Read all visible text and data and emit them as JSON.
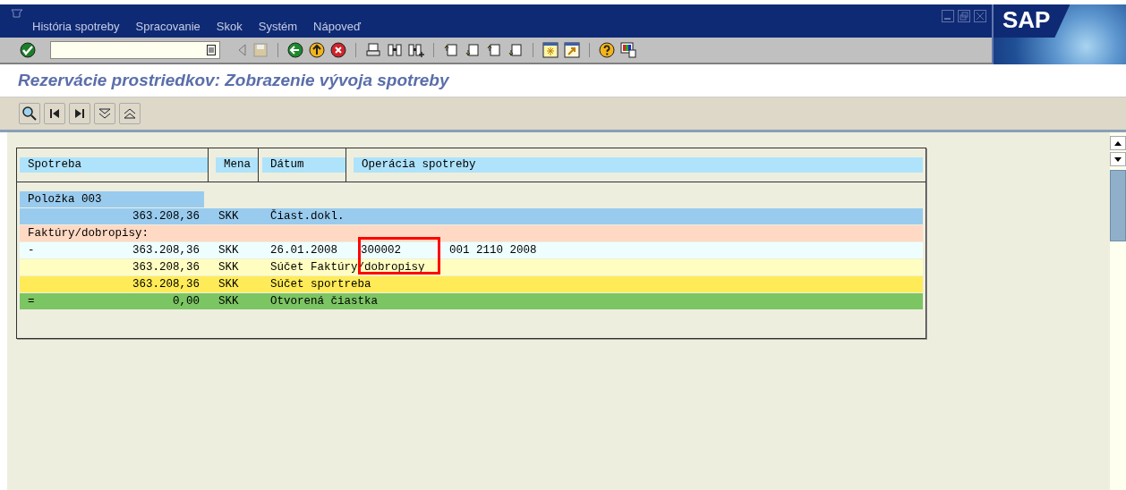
{
  "menu": [
    "História spotreby",
    "Spracovanie",
    "Skok",
    "Systém",
    "Nápoveď"
  ],
  "logo": "SAP",
  "title": "Rezervácie prostriedkov: Zobrazenie vývoja spotreby",
  "table": {
    "columns": [
      "Spotreba",
      "Mena",
      "Dátum",
      "Operácia spotreby"
    ],
    "rows": [
      {
        "kind": "group",
        "label": "Položka 003",
        "color": "#99cbee"
      },
      {
        "kind": "line",
        "amount": "363.208,36",
        "currency": "SKK",
        "text": "Čiast.dokl.",
        "color": "#99cbee"
      },
      {
        "kind": "section",
        "label": "Faktúry/dobropisy:",
        "color": "#ffd9c4"
      },
      {
        "kind": "line",
        "sign": "-",
        "amount": "363.208,36",
        "currency": "SKK",
        "date": "26.01.2008",
        "document": "300002",
        "marked": true,
        "text": "001 2110 2008",
        "color": "#eefeff"
      },
      {
        "kind": "line",
        "amount": "363.208,36",
        "currency": "SKK",
        "text": "Súčet Faktúry/dobropisy",
        "color": "#fffdc0"
      },
      {
        "kind": "line",
        "amount": "363.208,36",
        "currency": "SKK",
        "text": "Súčet sportreba",
        "color": "#ffeb57"
      },
      {
        "kind": "line",
        "sign": "=",
        "amount": "0,00",
        "currency": "SKK",
        "text": "Otvorená čiastka",
        "color": "#7cc563"
      }
    ]
  }
}
